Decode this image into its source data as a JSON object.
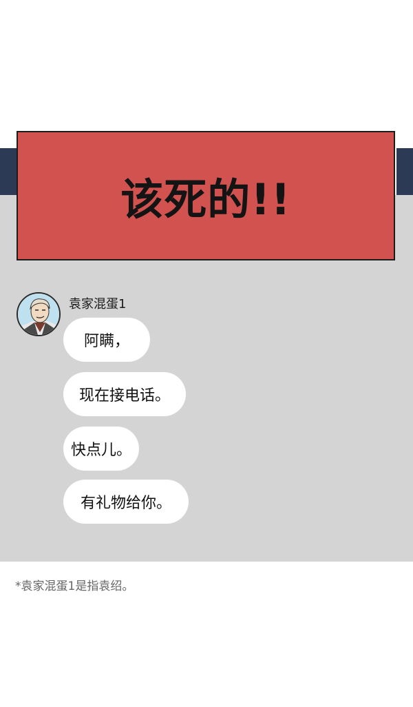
{
  "panel": {
    "shout": "该死的!!"
  },
  "chat": {
    "sender": "袁家混蛋1",
    "messages": [
      "阿瞒，",
      "现在接电话。",
      "快点儿。",
      "有礼物给你。"
    ]
  },
  "footnote": "*袁家混蛋1是指袁绍。",
  "colors": {
    "shout_background": "#d25250",
    "chat_background": "#d4d4d4",
    "side_bars": "#2c3a55",
    "bubble": "#ffffff"
  }
}
